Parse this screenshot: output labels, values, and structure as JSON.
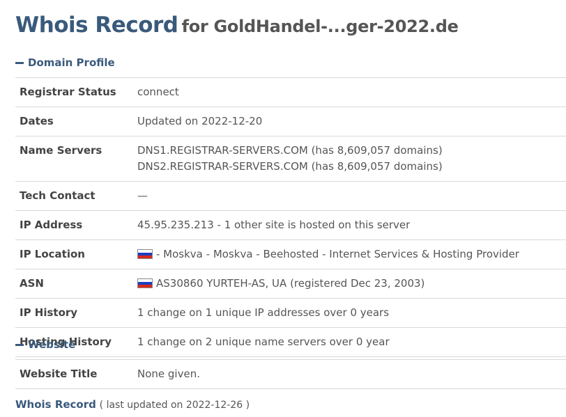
{
  "title": {
    "main": "Whois Record",
    "sub": "for GoldHandel-...ger-2022.de"
  },
  "sections": {
    "domain_profile": "Domain Profile",
    "website": "Website"
  },
  "domain_profile": {
    "registrar_status": {
      "label": "Registrar Status",
      "value": "connect"
    },
    "dates": {
      "label": "Dates",
      "value": "Updated on 2022-12-20"
    },
    "name_servers": {
      "label": "Name Servers",
      "values": [
        "DNS1.REGISTRAR-SERVERS.COM (has 8,609,057 domains)",
        "DNS2.REGISTRAR-SERVERS.COM (has 8,609,057 domains)"
      ]
    },
    "tech_contact": {
      "label": "Tech Contact",
      "value": "—"
    },
    "ip_address": {
      "label": "IP Address",
      "value": "45.95.235.213 - 1 other site is hosted on this server"
    },
    "ip_location": {
      "label": "IP Location",
      "value": "- Moskva - Moskva - Beehosted - Internet Services & Hosting Provider",
      "flag_icon": "russia-flag-icon"
    },
    "asn": {
      "label": "ASN",
      "value": "AS30860 YURTEH-AS, UA (registered Dec 23, 2003)",
      "flag_icon": "russia-flag-icon"
    },
    "ip_history": {
      "label": "IP History",
      "value": "1 change on 1 unique IP addresses over 0 years"
    },
    "hosting_history": {
      "label": "Hosting History",
      "value": "1 change on 2 unique name servers over 0 year"
    }
  },
  "website": {
    "website_title": {
      "label": "Website Title",
      "value": "None given."
    }
  },
  "footer": {
    "link": "Whois Record",
    "note": "( last updated on 2022-12-26 )"
  },
  "colors": {
    "accent": "#3a5a7c",
    "border": "#d8d8d8",
    "text": "#555555"
  }
}
